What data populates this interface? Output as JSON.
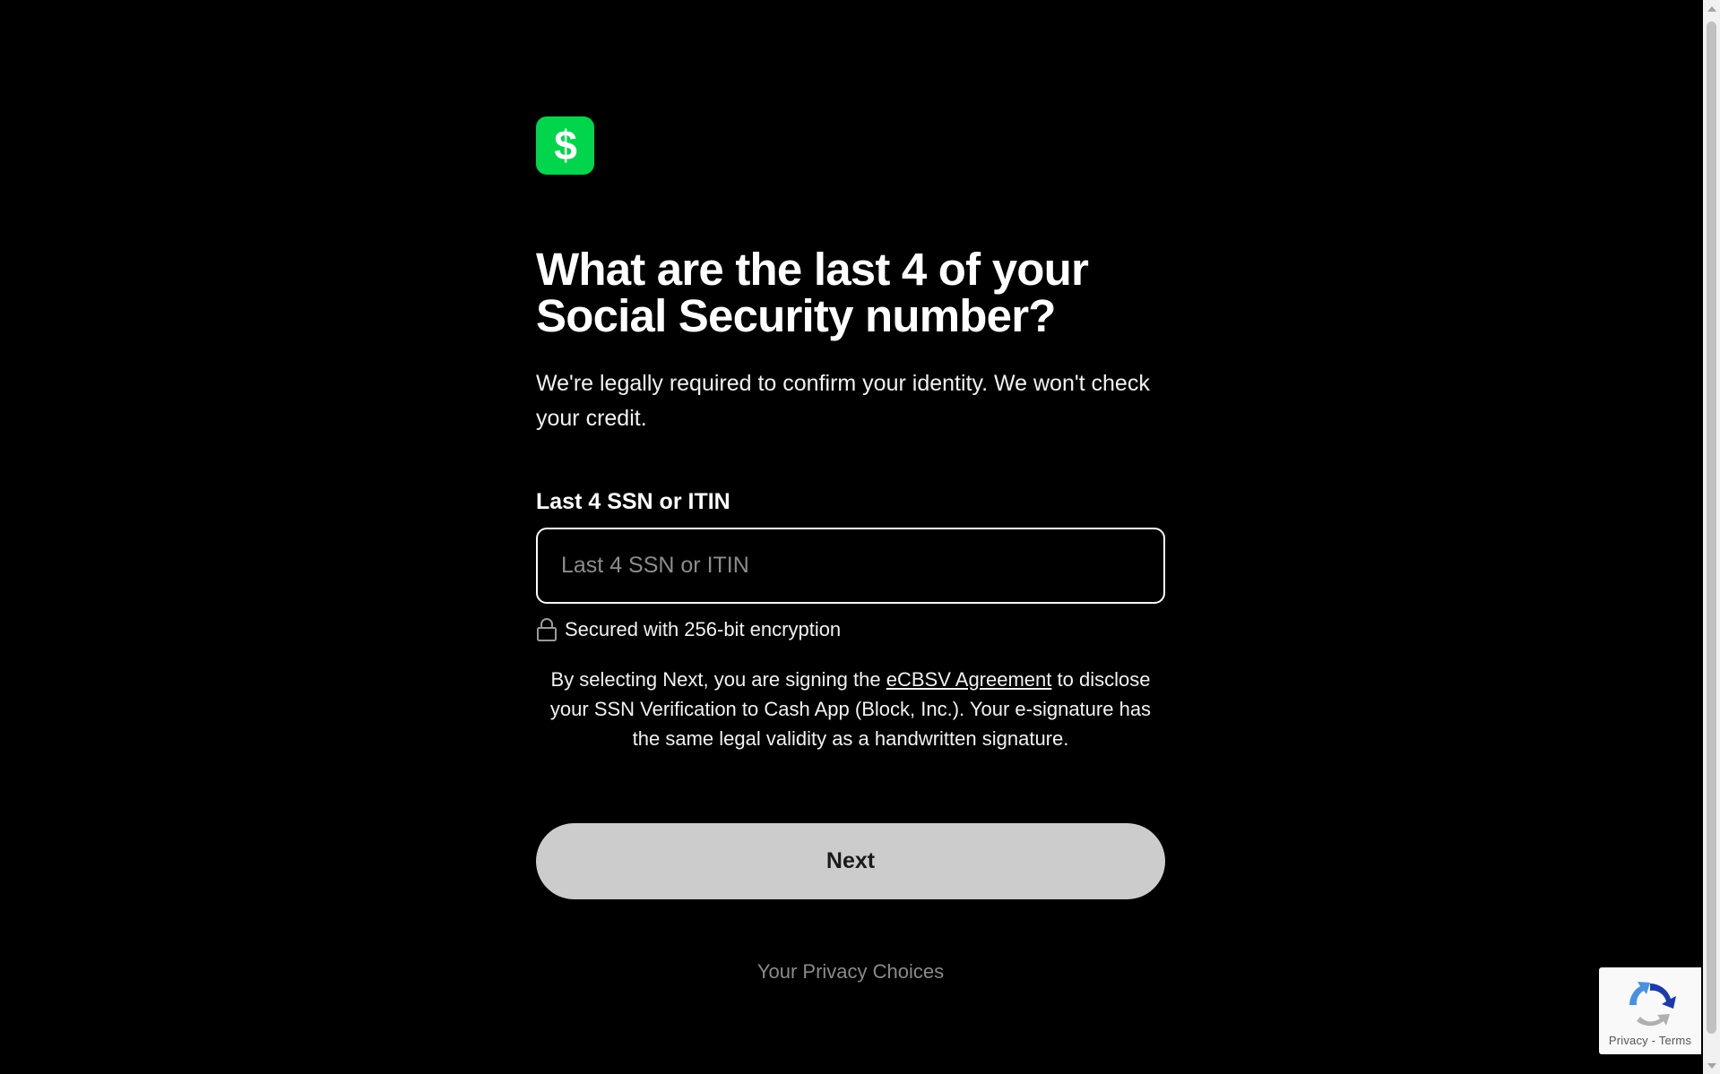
{
  "logo": {
    "icon": "dollar-sign-icon",
    "color": "#00d54b",
    "glyph": "$"
  },
  "headline": "What are the last 4 of your\nSocial Security number?",
  "subtext": "We're legally required to confirm your identity. We won't check your credit.",
  "ssn_field": {
    "label": "Last 4 SSN or ITIN",
    "placeholder": "Last 4 SSN or ITIN",
    "value": ""
  },
  "security_note": {
    "icon": "lock-icon",
    "text": "Secured with 256-bit encryption"
  },
  "legal": {
    "before": "By selecting Next, you are signing the ",
    "link": "eCBSV Agreement",
    "after": " to disclose your SSN Verification to Cash App (Block, Inc.). Your e-signature has the same legal validity as a handwritten signature."
  },
  "next_button": {
    "label": "Next"
  },
  "privacy_link": "Your Privacy Choices",
  "recaptcha": {
    "icon": "recaptcha-icon",
    "links": "Privacy - Terms"
  }
}
